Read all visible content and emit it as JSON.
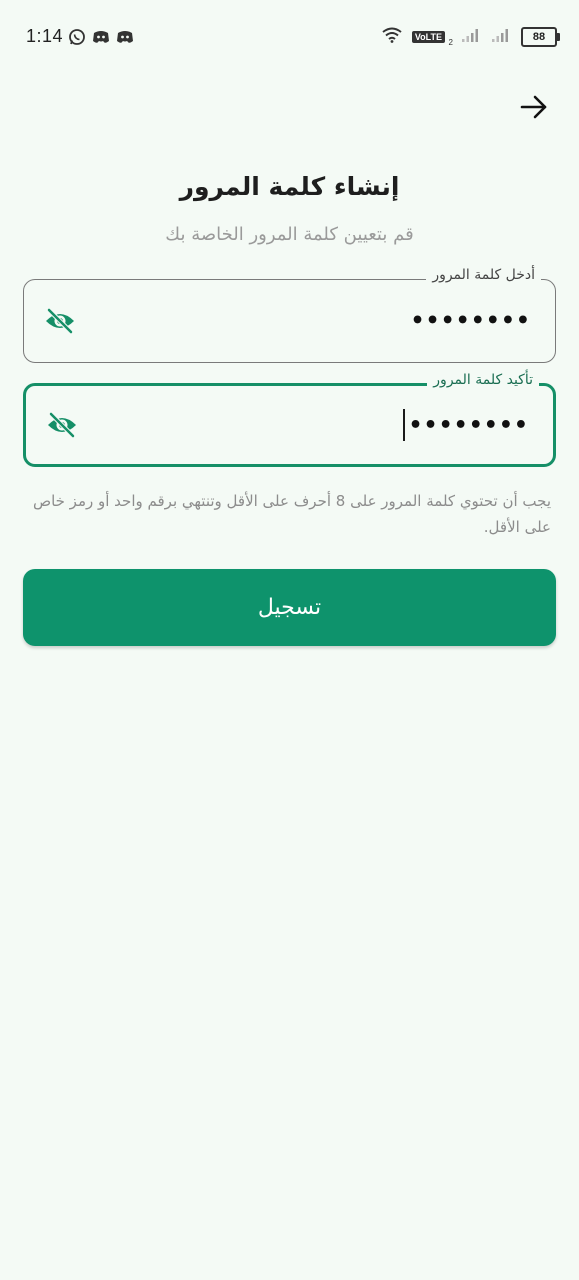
{
  "status_bar": {
    "time": "1:14",
    "left_icons": [
      "whatsapp-icon",
      "discord-icon",
      "discord-icon"
    ],
    "network_badge": "VoLTE",
    "network_badge_sub": "2",
    "battery": "88"
  },
  "header": {
    "back_icon": "arrow-right-icon"
  },
  "title": "إنشاء كلمة المرور",
  "subtitle": "قم بتعيين كلمة المرور الخاصة بك",
  "fields": {
    "password": {
      "label": "أدخل كلمة المرور",
      "value": "••••••••",
      "toggle_icon": "eye-off-icon"
    },
    "confirm_password": {
      "label": "تأكيد كلمة المرور",
      "value": "••••••••",
      "toggle_icon": "eye-off-icon"
    }
  },
  "hint": "يجب أن تحتوي كلمة المرور على 8 أحرف على الأقل وتنتهي برقم واحد أو رمز خاص على الأقل.",
  "register_button": {
    "label": "تسجيل"
  },
  "colors": {
    "accent": "#0e936c",
    "focus_border": "#158f67",
    "background": "#f4faf5",
    "muted_text": "#9a9a9a"
  }
}
